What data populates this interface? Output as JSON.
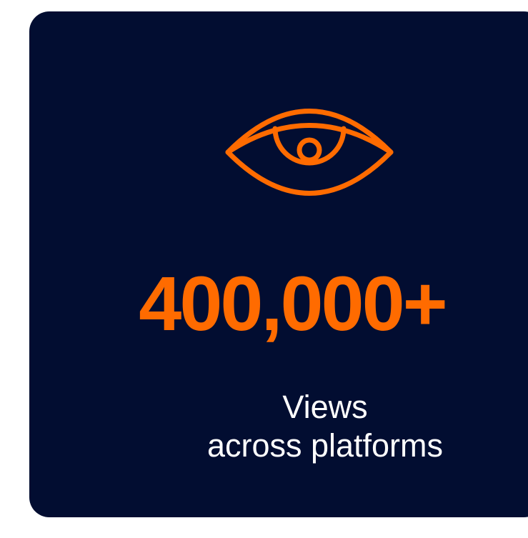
{
  "stat": {
    "value": "400,000+",
    "label_line1": "Views",
    "label_line2": "across platforms"
  },
  "icons": {
    "main": "eye-icon"
  },
  "colors": {
    "background": "#020d31",
    "accent": "#ff6b00",
    "text": "#ffffff"
  }
}
